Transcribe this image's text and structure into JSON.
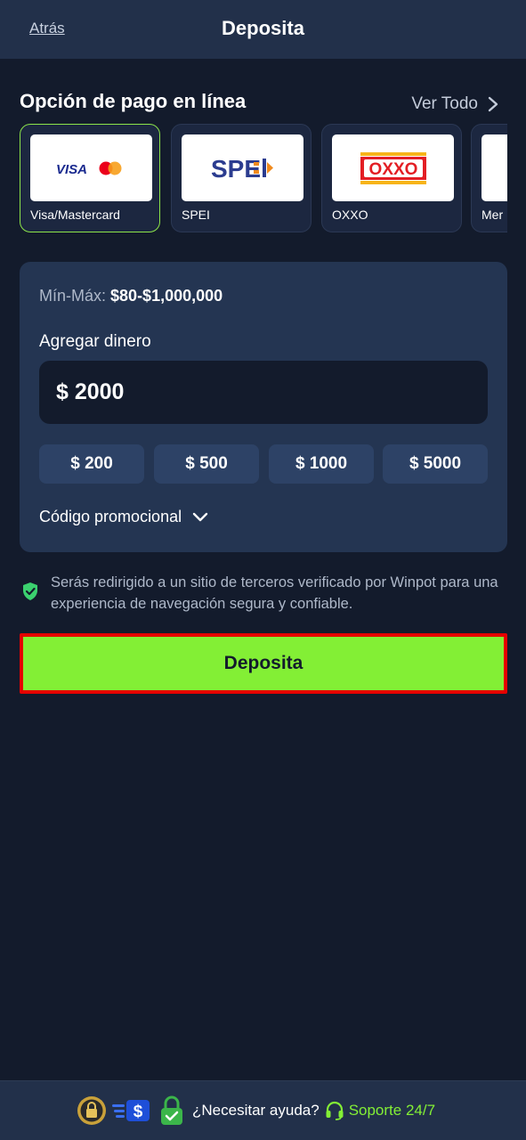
{
  "header": {
    "back_label": "Atrás",
    "title": "Deposita"
  },
  "payment_section": {
    "title": "Opción de pago en línea",
    "view_all_label": "Ver Todo",
    "methods": [
      {
        "label": "Visa/Mastercard",
        "logo_text": "VISA",
        "selected": true
      },
      {
        "label": "SPEI",
        "logo_text": "SPEI"
      },
      {
        "label": "OXXO",
        "logo_text": "OXXO"
      },
      {
        "label": "Mer"
      }
    ]
  },
  "deposit_panel": {
    "minmax_label": "Mín-Máx:",
    "minmax_value": "$80-$1,000,000",
    "add_money_label": "Agregar dinero",
    "amount_value": "$ 2000",
    "quick_amounts": [
      "$ 200",
      "$ 500",
      "$ 1000",
      "$ 5000"
    ],
    "promo_label": "Código promocional"
  },
  "notice": {
    "text": "Serás redirigido a un sitio de terceros verificado por Winpot para una experiencia de navegación segura y confiable."
  },
  "deposit_button_label": "Deposita",
  "footer": {
    "help_text": "¿Necesitar ayuda?",
    "support_label": "Soporte 24/7"
  },
  "colors": {
    "background": "#131b2c",
    "header": "#22304a",
    "panel": "#243552",
    "accent_green": "#83ef35",
    "highlight_red": "#e50000"
  }
}
